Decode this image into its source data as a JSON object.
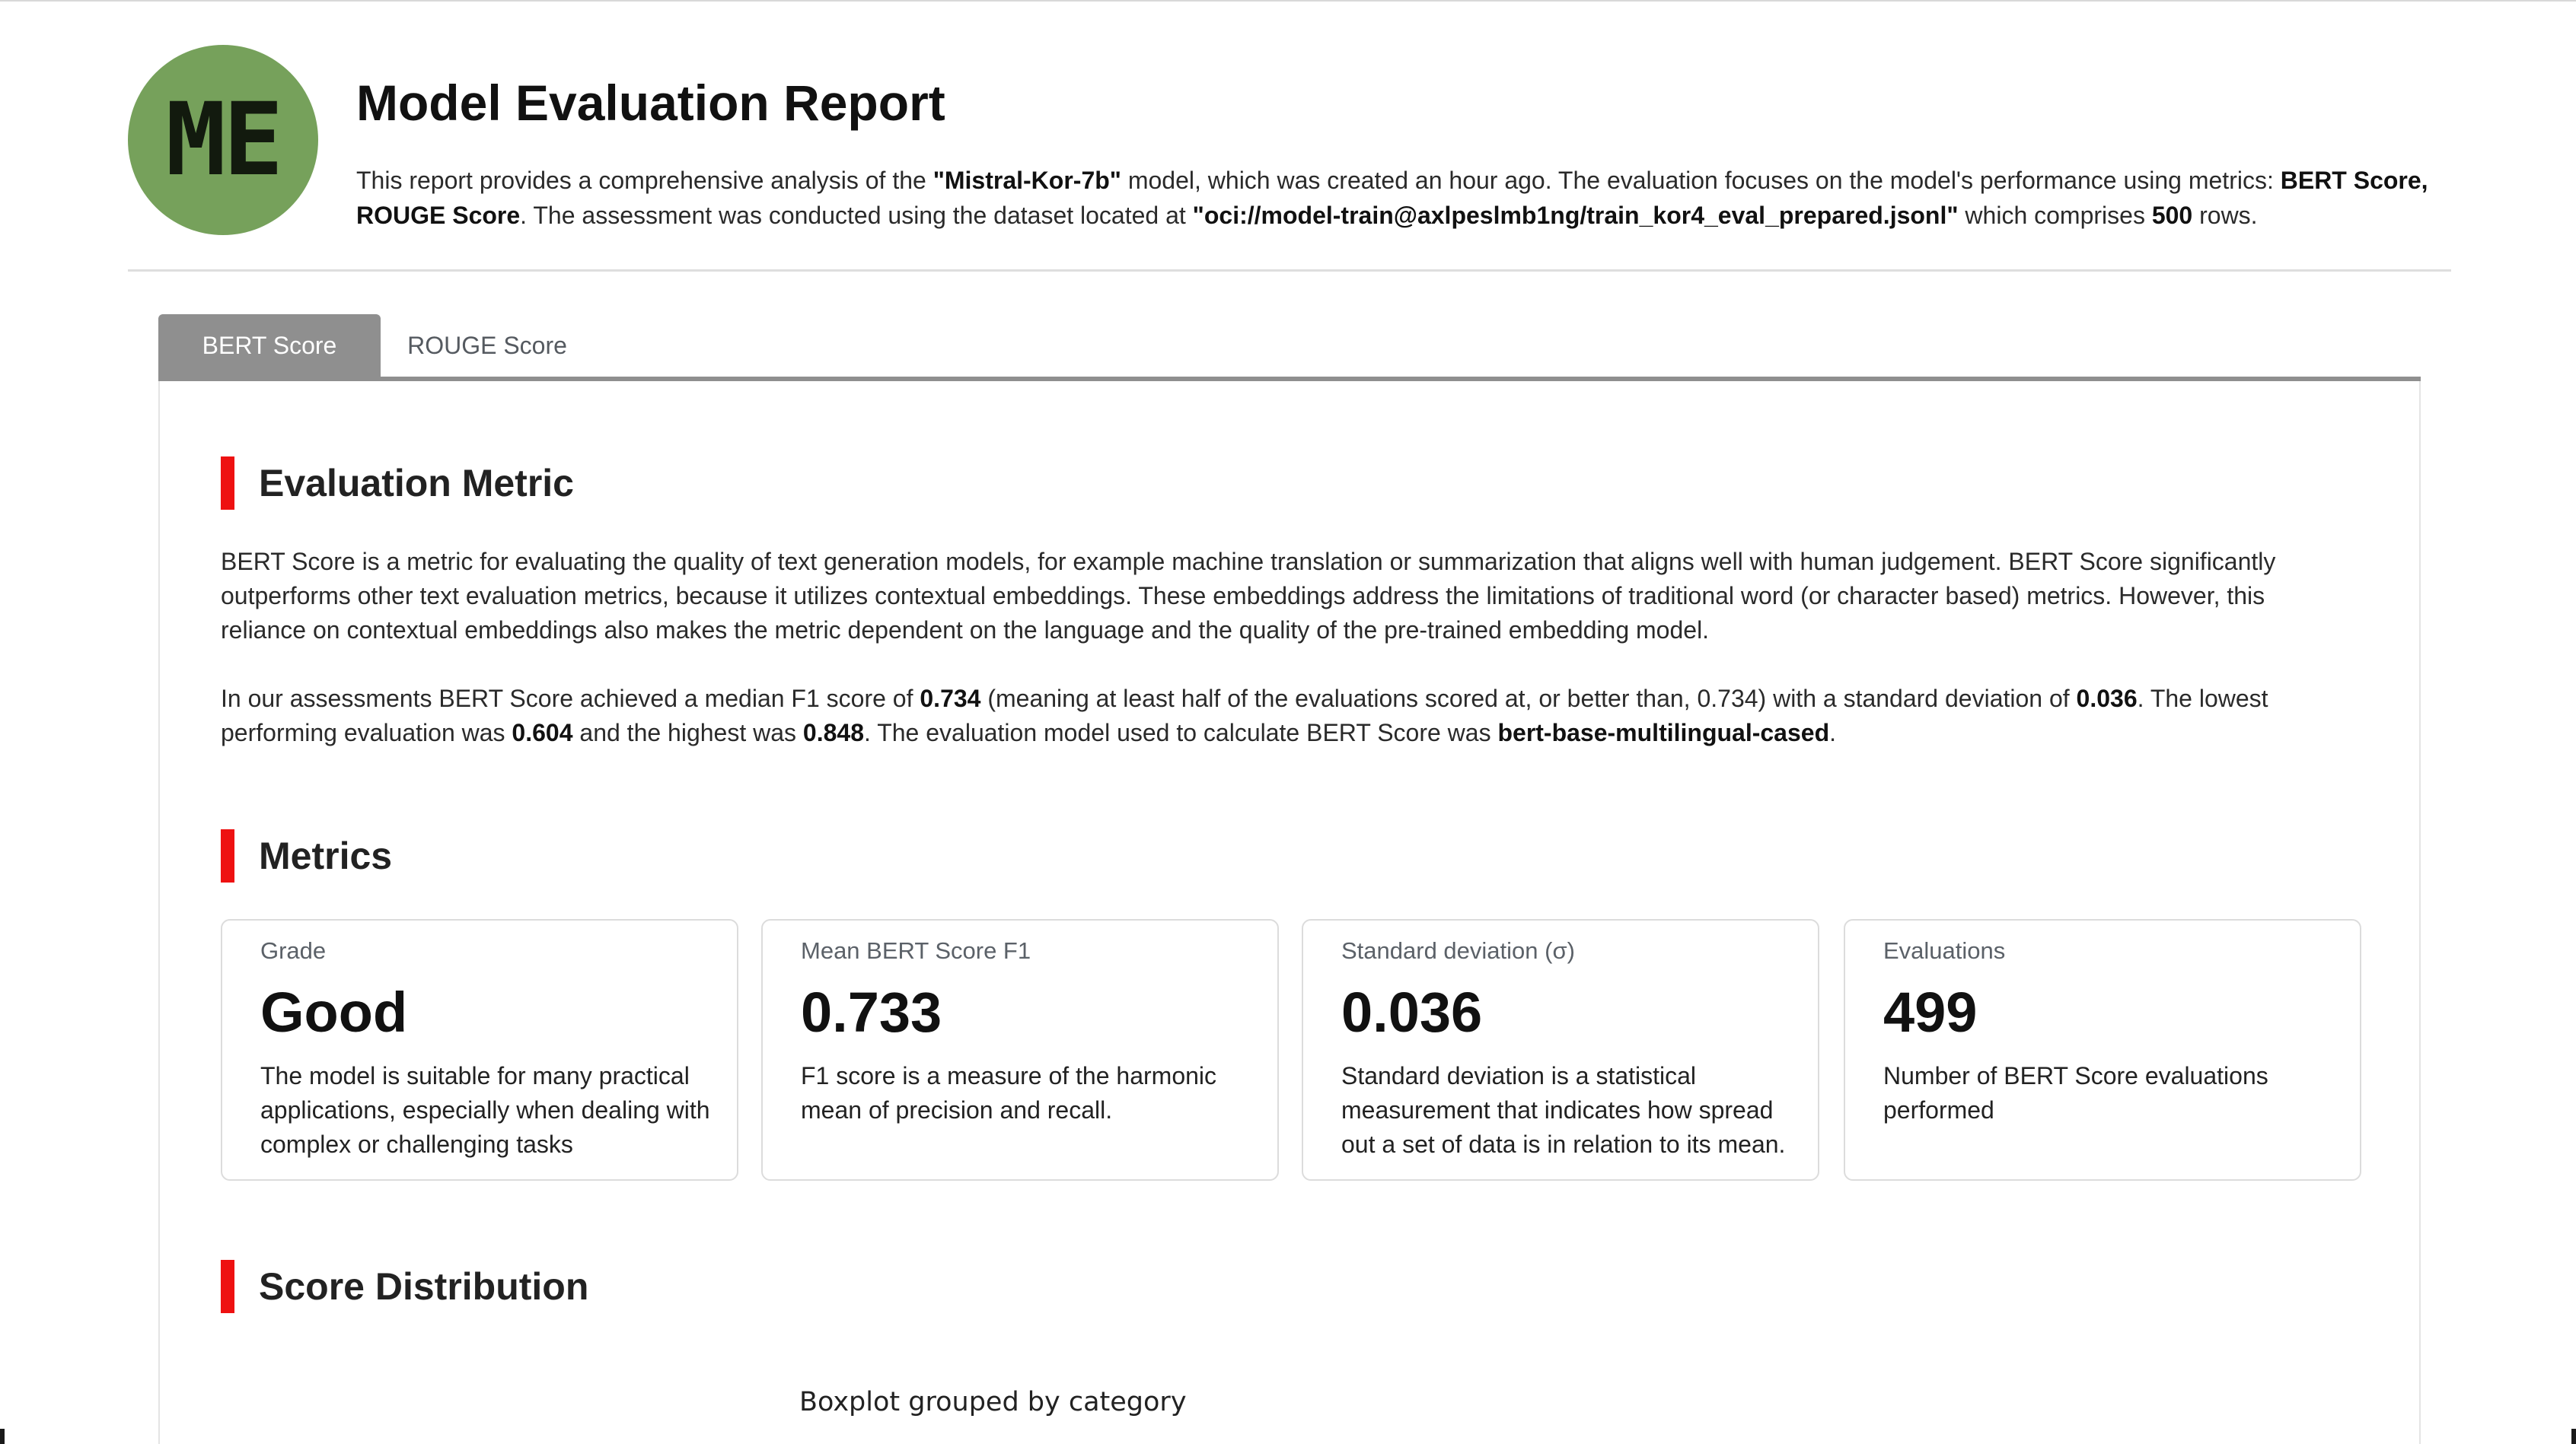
{
  "header": {
    "avatar_initials": "ME",
    "avatar_color": "#76a15b",
    "title": "Model Evaluation Report",
    "intro": {
      "t1": "This report provides a comprehensive analysis of the ",
      "model_name": "\"Mistral-Kor-7b\"",
      "t2": " model, which was created an hour ago. The evaluation focuses on the model's performance using metrics: ",
      "metrics": "BERT Score, ROUGE Score",
      "t3": ". The assessment was conducted using the dataset located at ",
      "dataset": "\"oci://model-train@axlpeslmb1ng/train_kor4_eval_prepared.jsonl\"",
      "t4": " which comprises ",
      "rows": "500",
      "t5": " rows."
    }
  },
  "tabs": [
    {
      "label": "BERT Score",
      "active": true
    },
    {
      "label": "ROUGE Score",
      "active": false
    }
  ],
  "sections": {
    "evaluation_metric": {
      "heading": "Evaluation Metric",
      "para1": "BERT Score is a metric for evaluating the quality of text generation models, for example machine translation or summarization that aligns well with human judgement. BERT Score significantly outperforms other text evaluation metrics, because it utilizes contextual embeddings. These embeddings address the limitations of traditional word (or character based) metrics. However, this reliance on contextual embeddings also makes the metric dependent on the language and the quality of the pre-trained embedding model.",
      "para2": {
        "t1": "In our assessments BERT Score achieved a median F1 score of ",
        "median": "0.734",
        "t2": " (meaning at least half of the evaluations scored at, or better than, 0.734) with a standard deviation of ",
        "std": "0.036",
        "t3": ". The lowest performing evaluation was ",
        "min": "0.604",
        "t4": " and the highest was ",
        "max": "0.848",
        "t5": ". The evaluation model used to calculate BERT Score was ",
        "model": "bert-base-multilingual-cased",
        "t6": "."
      }
    },
    "metrics": {
      "heading": "Metrics",
      "cards": [
        {
          "label": "Grade",
          "value": "Good",
          "desc": "The model is suitable for many practical applications, especially when dealing with complex or challenging tasks"
        },
        {
          "label": "Mean BERT Score F1",
          "value": "0.733",
          "desc": "F1 score is a measure of the harmonic mean of precision and recall."
        },
        {
          "label": "Standard deviation (σ)",
          "value": "0.036",
          "desc": "Standard deviation is a statistical measurement that indicates how spread out a set of data is in relation to its mean."
        },
        {
          "label": "Evaluations",
          "value": "499",
          "desc": "Number of BERT Score evaluations performed"
        }
      ]
    },
    "distribution": {
      "heading": "Score Distribution",
      "chart_title": "Boxplot grouped by category"
    }
  },
  "colors": {
    "accent_bar": "#ee1111",
    "tab_active_bg": "#8f8f8f"
  }
}
